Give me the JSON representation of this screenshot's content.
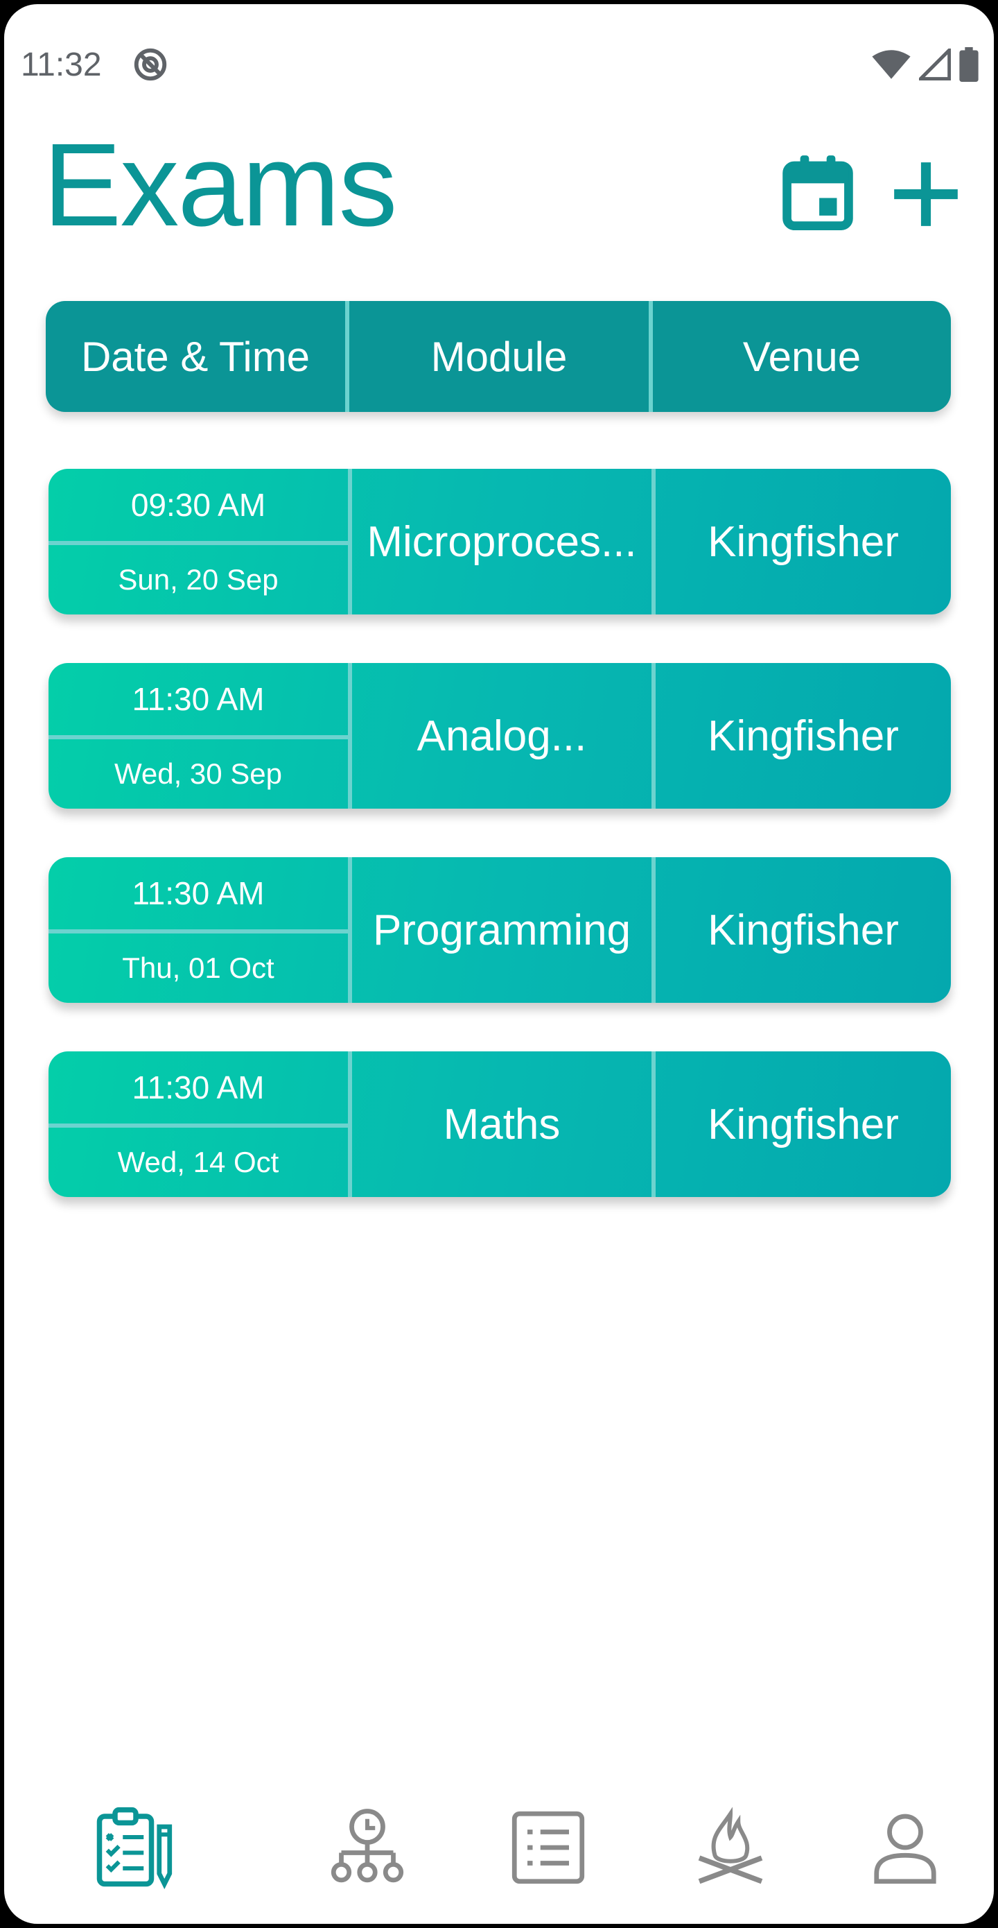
{
  "status_bar": {
    "time": "11:32"
  },
  "header": {
    "title": "Exams"
  },
  "table": {
    "columns": [
      "Date & Time",
      "Module",
      "Venue"
    ],
    "rows": [
      {
        "time": "09:30 AM",
        "date": "Sun, 20 Sep",
        "module": "Microproces...",
        "venue": "Kingfisher"
      },
      {
        "time": "11:30 AM",
        "date": "Wed, 30 Sep",
        "module": "Analog...",
        "venue": "Kingfisher"
      },
      {
        "time": "11:30 AM",
        "date": "Thu, 01 Oct",
        "module": "Programming",
        "venue": "Kingfisher"
      },
      {
        "time": "11:30 AM",
        "date": "Wed, 14 Oct",
        "module": "Maths",
        "venue": "Kingfisher"
      }
    ]
  },
  "nav": {
    "items": [
      "exams-icon",
      "timetable-icon",
      "tasks-icon",
      "campfire-icon",
      "profile-icon"
    ],
    "active": "exams-icon"
  },
  "colors": {
    "primary": "#0b9596",
    "accent_start": "#04cea9",
    "accent_end": "#04a8ae",
    "divider": "#6cd3cf",
    "nav_inactive": "#8a8a8a"
  }
}
